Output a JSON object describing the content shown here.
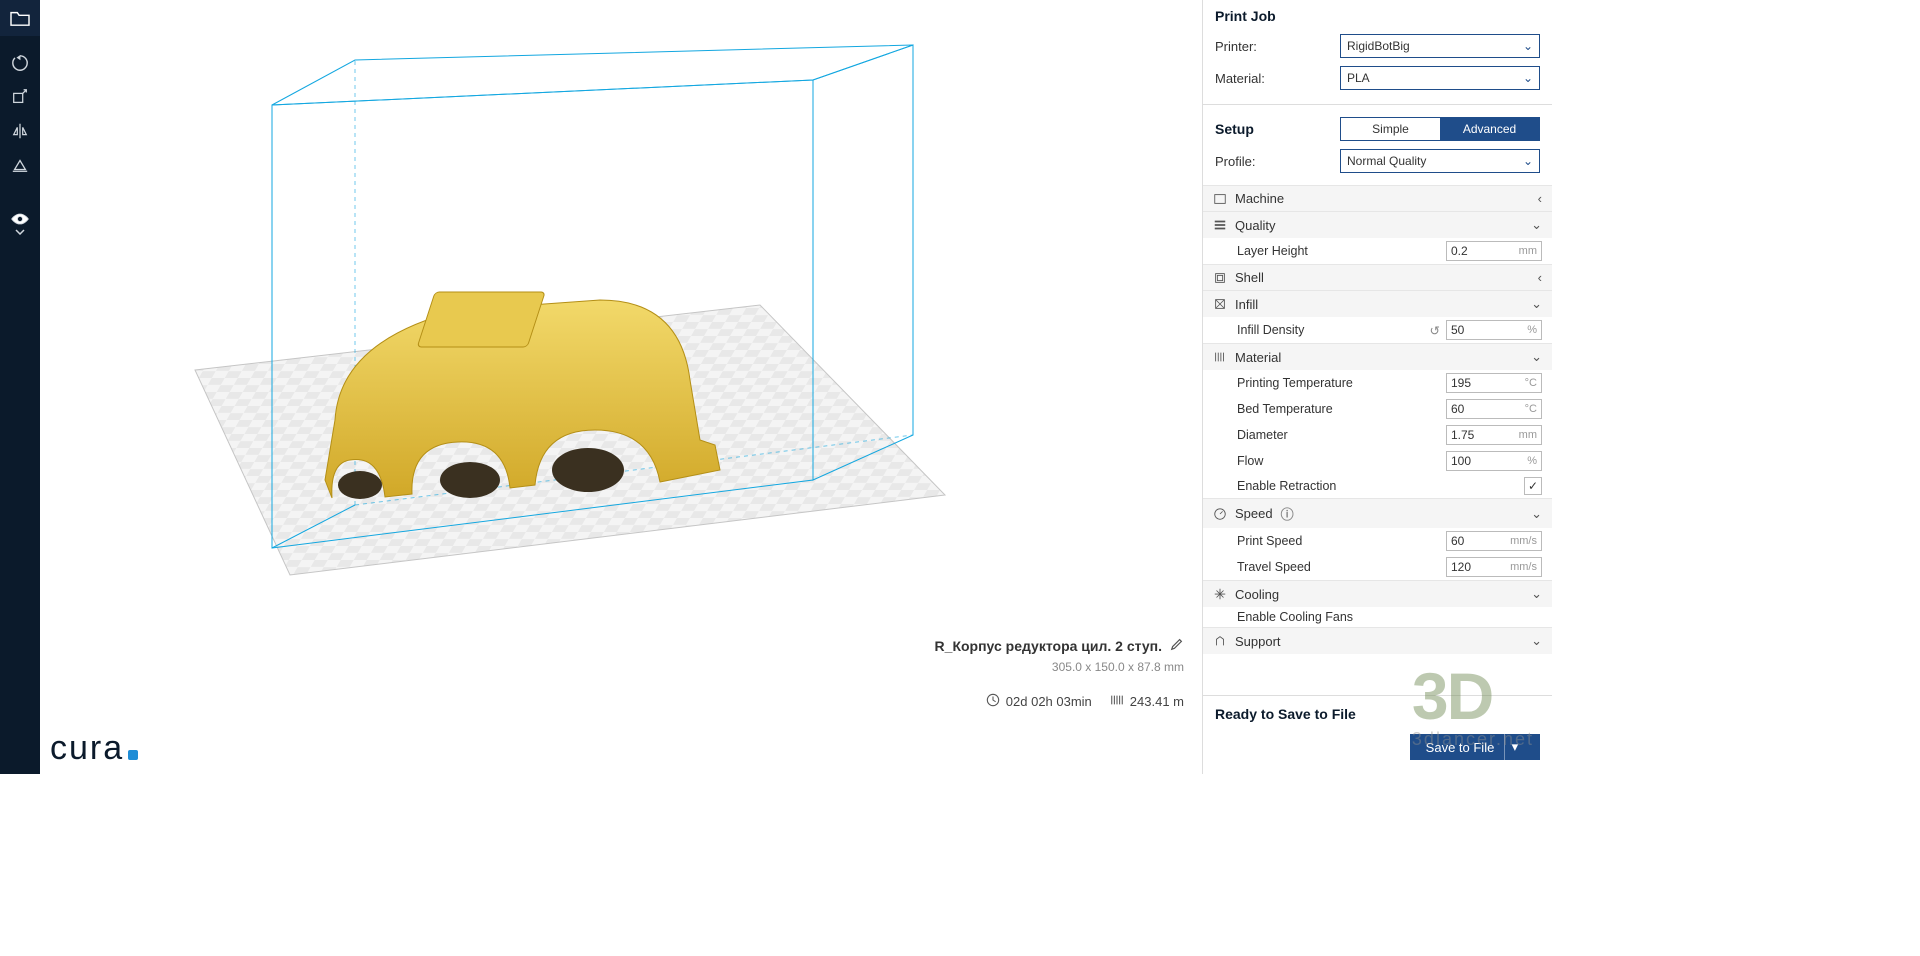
{
  "sidebar": {
    "tools": [
      "open-file",
      "rotate",
      "scale",
      "mirror",
      "layflat",
      "view-mode"
    ]
  },
  "viewport": {
    "model_name": "R_Корпус редуктора цил. 2 ступ.",
    "dimensions": "305.0 x 150.0 x 87.8 mm",
    "print_time": "02d 02h 03min",
    "filament_length": "243.41 m",
    "logo_text": "cura"
  },
  "panel": {
    "print_job_header": "Print Job",
    "printer_label": "Printer:",
    "printer_value": "RigidBotBig",
    "material_label": "Material:",
    "material_value": "PLA",
    "setup_header": "Setup",
    "mode_simple": "Simple",
    "mode_advanced": "Advanced",
    "profile_label": "Profile:",
    "profile_value": "Normal Quality",
    "categories": {
      "machine": "Machine",
      "quality": "Quality",
      "shell": "Shell",
      "infill": "Infill",
      "material": "Material",
      "speed": "Speed",
      "cooling": "Cooling",
      "support": "Support"
    },
    "fields": {
      "layer_height": {
        "label": "Layer Height",
        "value": "0.2",
        "unit": "mm"
      },
      "infill_density": {
        "label": "Infill Density",
        "value": "50",
        "unit": "%"
      },
      "printing_temp": {
        "label": "Printing Temperature",
        "value": "195",
        "unit": "°C"
      },
      "bed_temp": {
        "label": "Bed Temperature",
        "value": "60",
        "unit": "°C"
      },
      "diameter": {
        "label": "Diameter",
        "value": "1.75",
        "unit": "mm"
      },
      "flow": {
        "label": "Flow",
        "value": "100",
        "unit": "%"
      },
      "enable_retraction": {
        "label": "Enable Retraction",
        "checked": true
      },
      "print_speed": {
        "label": "Print Speed",
        "value": "60",
        "unit": "mm/s"
      },
      "travel_speed": {
        "label": "Travel Speed",
        "value": "120",
        "unit": "mm/s"
      },
      "enable_cooling_fans": {
        "label": "Enable Cooling Fans"
      }
    },
    "footer_title": "Ready to Save to File",
    "save_button": "Save to File"
  },
  "watermark": {
    "big": "3D",
    "small": "3dlancer.net"
  }
}
